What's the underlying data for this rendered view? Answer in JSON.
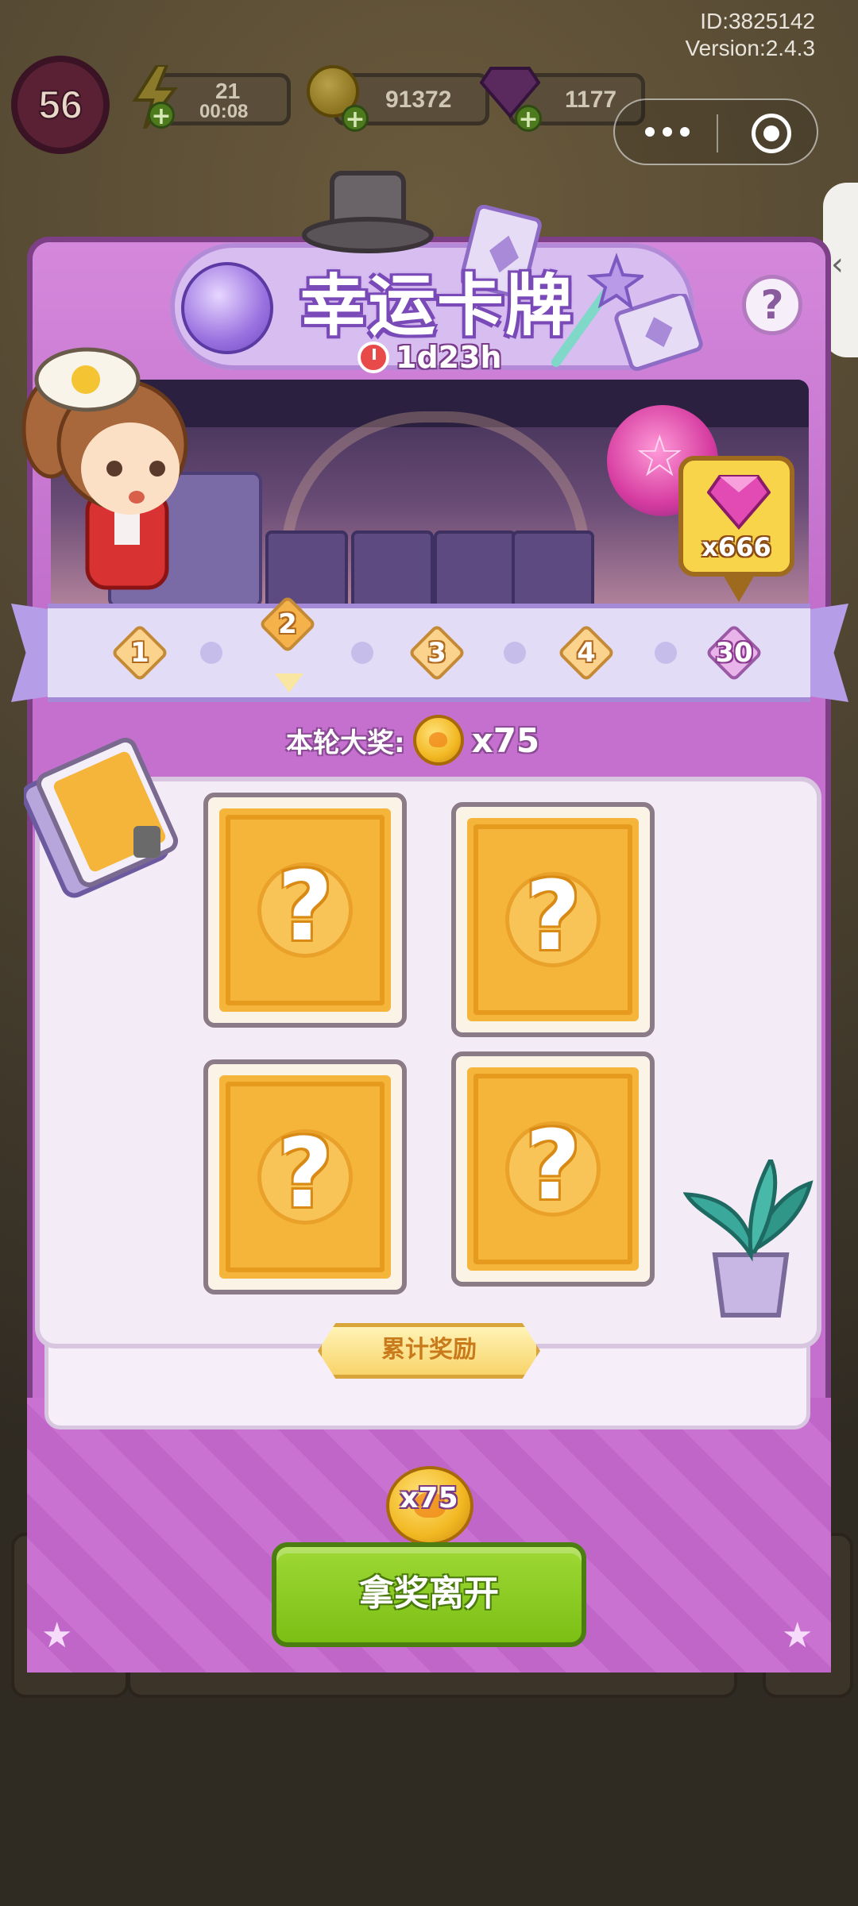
{
  "hud": {
    "level": "56",
    "energy": {
      "value": "21",
      "timer": "00:08",
      "icon": "lightning-icon"
    },
    "coins": {
      "value": "91372",
      "icon": "coin-icon"
    },
    "gems": {
      "value": "1177",
      "icon": "gem-icon"
    }
  },
  "meta": {
    "id": "ID:3825142",
    "version": "Version:2.4.3"
  },
  "event": {
    "title": "幸运卡牌",
    "timer": "1d23h",
    "gem_reward": "x666",
    "progress": {
      "nodes": [
        "1",
        "2",
        "3",
        "4",
        "30"
      ],
      "current_index": 1
    },
    "grand_prize_label": "本轮大奖:",
    "grand_prize_count": "x75",
    "cards": [
      {
        "symbol": "?"
      },
      {
        "symbol": "?"
      },
      {
        "symbol": "?"
      },
      {
        "symbol": "?"
      }
    ],
    "accumulated_label": "累计奖励",
    "accumulated_count": "x75",
    "claim_label": "拿奖离开"
  },
  "colors": {
    "panel": "#c56fcf",
    "card": "#f4b53a",
    "claim_button": "#8ccc22",
    "gem": "#d63ca0"
  }
}
